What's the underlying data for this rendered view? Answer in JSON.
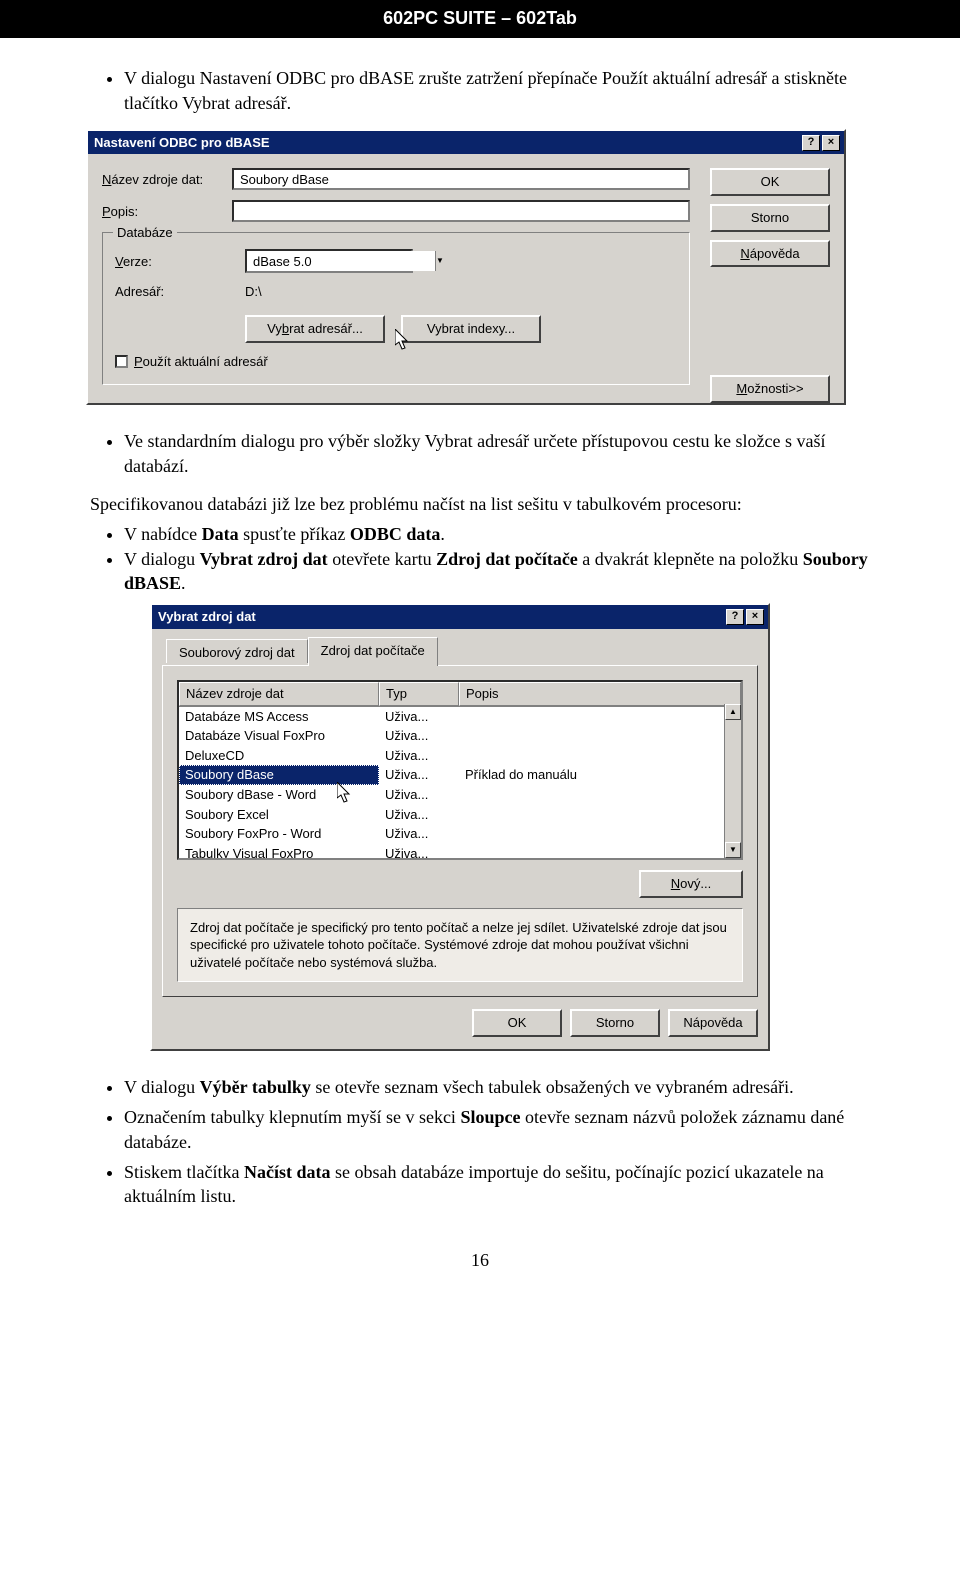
{
  "header": "602PC SUITE – 602Tab",
  "intro_text": "V dialogu Nastavení ODBC pro dBASE zrušte zatržení přepínače Použít aktuální adresář a stiskněte tlačítko Vybrat adresář.",
  "dialog1": {
    "title": "Nastavení ODBC pro dBASE",
    "help_btn": "?",
    "close_btn": "×",
    "label_name": "Název zdroje dat:",
    "hot_name": "N",
    "value_name": "Soubory dBase",
    "label_desc": "Popis:",
    "hot_desc": "P",
    "value_desc": "",
    "group_legend": "Databáze",
    "label_version": "Verze:",
    "hot_version": "V",
    "value_version": "dBase 5.0",
    "label_dir": "Adresář:",
    "value_dir": "D:\\",
    "btn_selectdir": "Vybrat adresář...",
    "btn_selectdir_hot": "b",
    "btn_selectidx": "Vybrat indexy...",
    "chk_label": "Použít aktuální adresář",
    "chk_hot": "P",
    "btn_ok": "OK",
    "btn_cancel": "Storno",
    "btn_help": "Nápověda",
    "btn_help_hot": "N",
    "btn_more": "Možnosti>>",
    "btn_more_hot": "M"
  },
  "mid_text": "Ve standardním dialogu pro výběr složky Vybrat adresář určete přístupovou cestu ke složce s vaší databází.",
  "mid_para": "Specifikovanou databázi již lze bez problému načíst na list sešitu v tabulkovém procesoru:",
  "mid_list1": "V nabídce Data spusťte příkaz ODBC data.",
  "mid_list2": "V dialogu Vybrat zdroj dat otevřete kartu Zdroj dat počítače a dvakrát klepněte na položku Soubory dBASE.",
  "dialog2": {
    "title": "Vybrat zdroj dat",
    "tab_file": "Souborový zdroj dat",
    "tab_machine": "Zdroj dat počítače",
    "col1": "Název zdroje dat",
    "col2": "Typ",
    "col3": "Popis",
    "rows": [
      {
        "c1": "Databáze MS Access",
        "c2": "Uživa...",
        "c3": ""
      },
      {
        "c1": "Databáze Visual FoxPro",
        "c2": "Uživa...",
        "c3": ""
      },
      {
        "c1": "DeluxeCD",
        "c2": "Uživa...",
        "c3": ""
      },
      {
        "c1": "Soubory dBase",
        "c2": "Uživa...",
        "c3": "Příklad do manuálu",
        "sel": true
      },
      {
        "c1": "Soubory dBase - Word",
        "c2": "Uživa...",
        "c3": ""
      },
      {
        "c1": "Soubory Excel",
        "c2": "Uživa...",
        "c3": ""
      },
      {
        "c1": "Soubory FoxPro - Word",
        "c2": "Uživa...",
        "c3": ""
      },
      {
        "c1": "Tabulky Visual FoxPro",
        "c2": "Uživa...",
        "c3": ""
      }
    ],
    "btn_new": "Nový...",
    "btn_new_hot": "N",
    "desc": "Zdroj dat počítače je specifický pro tento počítač a nelze jej sdílet. Uživatelské zdroje dat jsou specifické pro uživatele tohoto počítače. Systémové zdroje dat mohou používat všichni uživatelé počítače nebo systémová služba.",
    "btn_ok": "OK",
    "btn_cancel": "Storno",
    "btn_help": "Nápověda"
  },
  "foot1": "V dialogu Výběr tabulky se otevře seznam všech tabulek obsažených ve vybraném adresáři.",
  "foot2": "Označením tabulky klepnutím myší se v sekci Sloupce otevře seznam názvů položek záznamu dané databáze.",
  "foot3": "Stiskem tlačítka Načíst data se obsah databáze importuje do sešitu, počínajíc pozicí ukazatele na aktuálním listu.",
  "page_number": "16"
}
